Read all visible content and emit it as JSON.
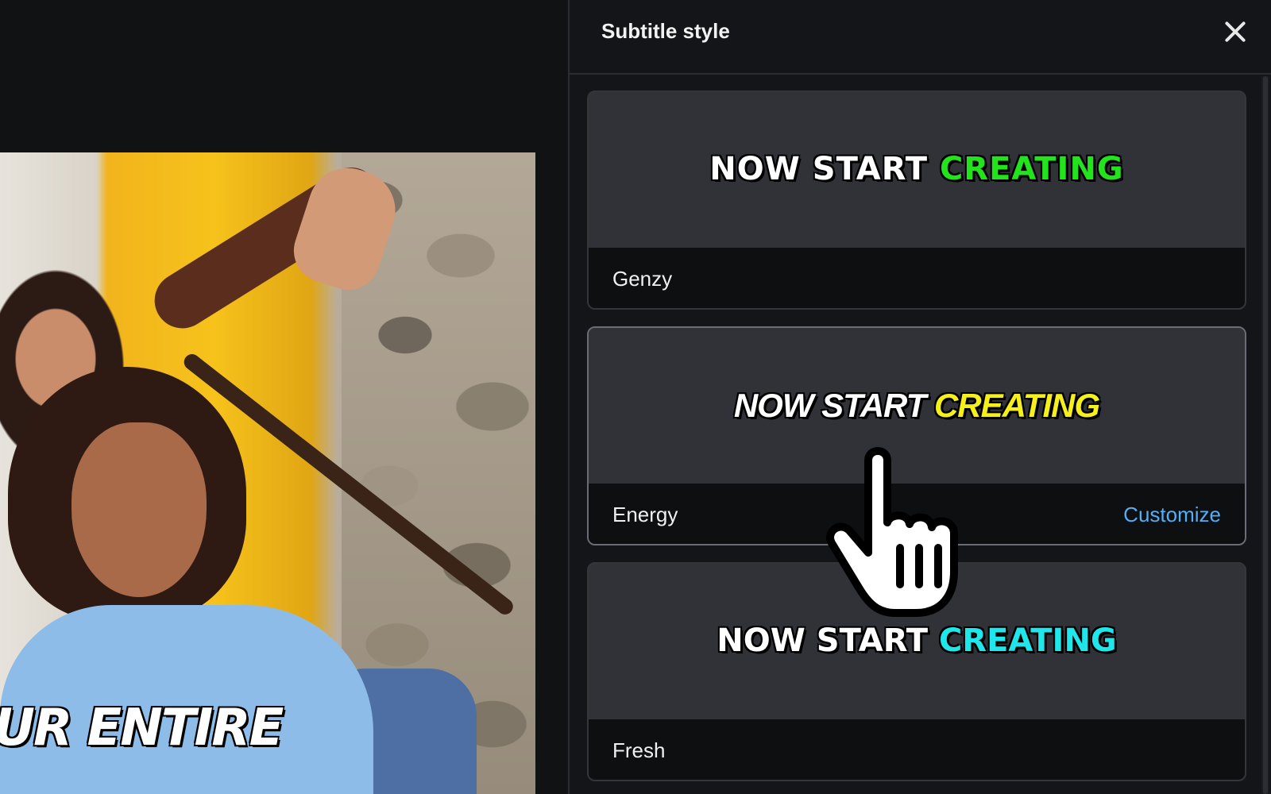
{
  "video": {
    "caption": "UR ENTIRE"
  },
  "panel": {
    "title": "Subtitle style",
    "close_label": "close"
  },
  "styles": [
    {
      "name": "Genzy",
      "preview_prefix": "NOW START ",
      "preview_highlight": "CREATING",
      "highlight_color": "#22e31c"
    },
    {
      "name": "Energy",
      "preview_prefix": "NOW START ",
      "preview_highlight": "CREATING",
      "highlight_color": "#f5ef1a",
      "action_label": "Customize"
    },
    {
      "name": "Fresh",
      "preview_prefix": "NOW START ",
      "preview_highlight": "CREATING",
      "highlight_color": "#1fe6ea"
    }
  ],
  "colors": {
    "accent_link": "#53aef5",
    "panel_bg": "#141518"
  }
}
